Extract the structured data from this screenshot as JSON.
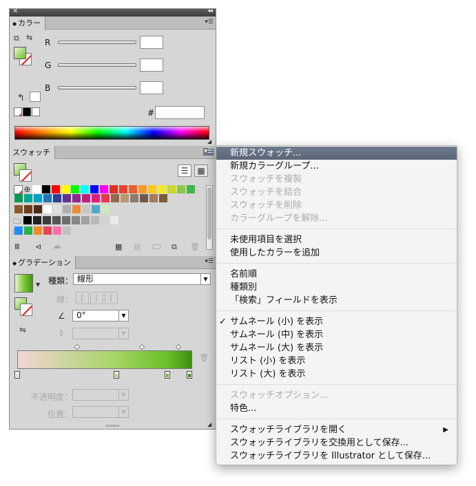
{
  "color_panel": {
    "tab_label": "カラー",
    "channels": [
      {
        "label": "R",
        "value": ""
      },
      {
        "label": "G",
        "value": ""
      },
      {
        "label": "B",
        "value": ""
      }
    ],
    "hex_label": "#",
    "hex_value": ""
  },
  "swatches_panel": {
    "tab_label": "スウォッチ",
    "swatch_colors": [
      [
        "#ffffff",
        "#000000",
        "#ff0000",
        "#ffff00",
        "#00ff00",
        "#00ffff",
        "#0000ff",
        "#ff00ff",
        "#e0301e",
        "#e8422f",
        "#f05c2c",
        "#f79a2a",
        "#f9c91d",
        "#f2e729",
        "#c8d92d",
        "#8dc63f",
        "#40b649"
      ],
      [
        "#009a57",
        "#00a693",
        "#00a1c8",
        "#1e76bc",
        "#2d3f96",
        "#653293",
        "#93278f",
        "#bd1e7d",
        "#e5197a",
        "#e8364a",
        "#926a4a",
        "#b59770",
        "#8c7b6b",
        "#6b5a4b",
        "#a37b5b",
        "#7a5c3c"
      ],
      [
        "#8b5a2b",
        "#6e3f1c",
        "#4a2c1a",
        "#ffffff",
        "#e0e0e0",
        "#b0b0b0",
        "#ec8a3a",
        "#c8c8c8",
        "#50a8c8",
        "#d0e8c0"
      ],
      [
        "#000000",
        "#222222",
        "#3c3c3c",
        "#555555",
        "#6e6e6e",
        "#878787",
        "#a0a0a0",
        "#b9b9b9",
        "#d2d2d2",
        "#ebebeb"
      ],
      [
        "#1e90ff",
        "#2ab04a",
        "#f08a24",
        "#e8455a",
        "#ff6fa8",
        "#c0c0c0"
      ]
    ]
  },
  "gradient_panel": {
    "tab_label": "グラデーション",
    "type_label": "種類：",
    "type_value": "線形",
    "stroke_label": "線：",
    "angle_value": "0°",
    "aspect_value": "",
    "opacity_label": "不透明度：",
    "location_label": "位置："
  },
  "menu": {
    "groups": [
      [
        {
          "label": "新規スウォッチ...",
          "enabled": true,
          "highlighted": true
        },
        {
          "label": "新規カラーグループ...",
          "enabled": true
        },
        {
          "label": "スウォッチを複製",
          "enabled": false
        },
        {
          "label": "スウォッチを結合",
          "enabled": false
        },
        {
          "label": "スウォッチを削除",
          "enabled": false
        },
        {
          "label": "カラーグループを解除...",
          "enabled": false
        }
      ],
      [
        {
          "label": "未使用項目を選択",
          "enabled": true
        },
        {
          "label": "使用したカラーを追加",
          "enabled": true
        }
      ],
      [
        {
          "label": "名前順",
          "enabled": true
        },
        {
          "label": "種類別",
          "enabled": true
        },
        {
          "label": "「検索」フィールドを表示",
          "enabled": true
        }
      ],
      [
        {
          "label": "サムネール (小) を表示",
          "enabled": true,
          "checked": true
        },
        {
          "label": "サムネール (中) を表示",
          "enabled": true
        },
        {
          "label": "サムネール (大) を表示",
          "enabled": true
        },
        {
          "label": "リスト (小) を表示",
          "enabled": true
        },
        {
          "label": "リスト (大) を表示",
          "enabled": true
        }
      ],
      [
        {
          "label": "スウォッチオプション...",
          "enabled": false
        },
        {
          "label": "特色...",
          "enabled": true
        }
      ],
      [
        {
          "label": "スウォッチライブラリを開く",
          "enabled": true,
          "submenu": true
        },
        {
          "label": "スウォッチライブラリを交換用として保存...",
          "enabled": true
        },
        {
          "label": "スウォッチライブラリを Illustrator として保存...",
          "enabled": true
        }
      ]
    ],
    "check_glyph": "✓",
    "submenu_glyph": "▶"
  },
  "colors": {
    "highlight": "#5f6b7c",
    "gradient_start": "#f2d5d7",
    "gradient_end": "#3d8f0b"
  }
}
